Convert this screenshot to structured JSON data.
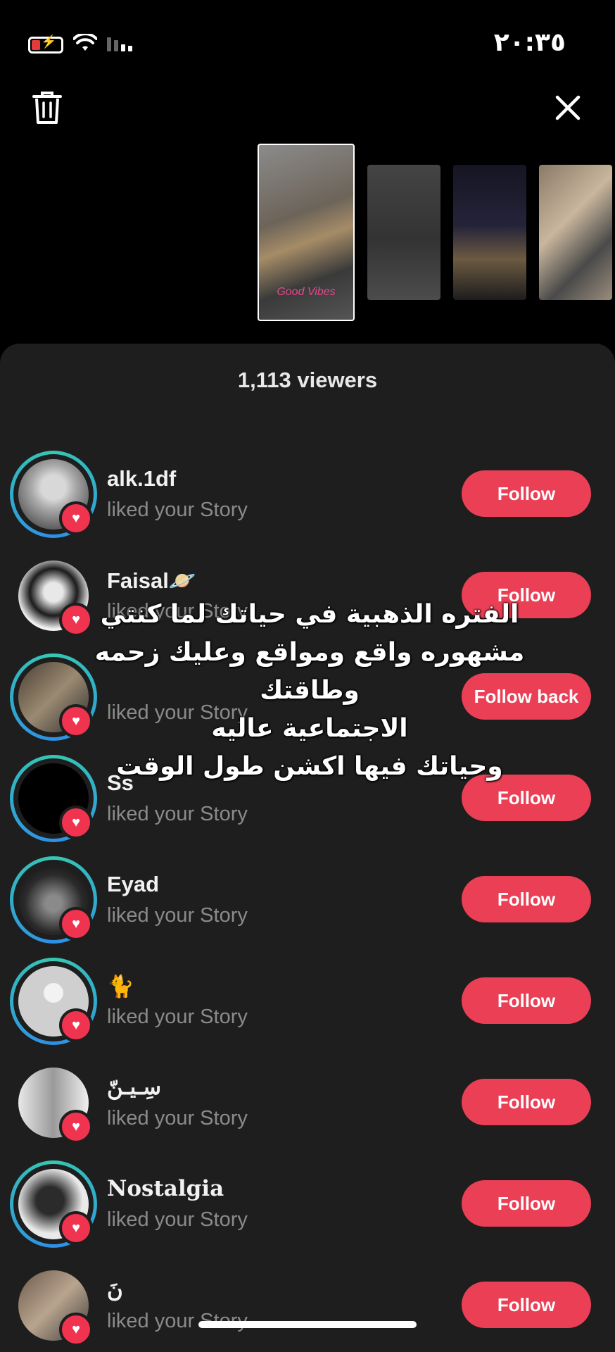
{
  "status": {
    "time": "٢٠:٣٥"
  },
  "sheet": {
    "title": "1,113 viewers"
  },
  "thumbnails": [
    {
      "label": "Good Vibes"
    },
    {
      "label": ""
    },
    {
      "label": ""
    },
    {
      "label": ""
    }
  ],
  "viewers": [
    {
      "name": "alk.1df",
      "subtitle": "liked your Story",
      "button": "Follow",
      "ring": true
    },
    {
      "name": "Faisal🪐",
      "subtitle": "liked your Story",
      "button": "Follow",
      "ring": false
    },
    {
      "name": "",
      "subtitle": "liked your Story",
      "button": "Follow back",
      "ring": true
    },
    {
      "name": "Ss",
      "subtitle": "liked your Story",
      "button": "Follow",
      "ring": true
    },
    {
      "name": "Eyad",
      "subtitle": "liked your Story",
      "button": "Follow",
      "ring": true
    },
    {
      "name": "🐈",
      "subtitle": "liked your Story",
      "button": "Follow",
      "ring": true
    },
    {
      "name": "سِـيـنّ",
      "subtitle": "liked your Story",
      "button": "Follow",
      "ring": false
    },
    {
      "name": "Nostalgia",
      "subtitle": "liked your Story",
      "button": "Follow",
      "ring": true
    },
    {
      "name": "نَ",
      "subtitle": "liked your Story",
      "button": "Follow",
      "ring": false
    }
  ],
  "overlay": {
    "text": "الفتره الذهبية في حياتك لما كنتي\nمشهوره واقع ومواقع وعليك زحمه\nوطاقتك\nالاجتماعية عاليه\nوحياتك فيها اكشن طول الوقت"
  },
  "colors": {
    "accent": "#ea3f55",
    "sheet_bg": "#1e1e1e",
    "heart": "#f0334f"
  },
  "icons": [
    "battery-icon",
    "wifi-icon",
    "cellular-icon",
    "trash-icon",
    "close-icon",
    "heart-icon"
  ]
}
